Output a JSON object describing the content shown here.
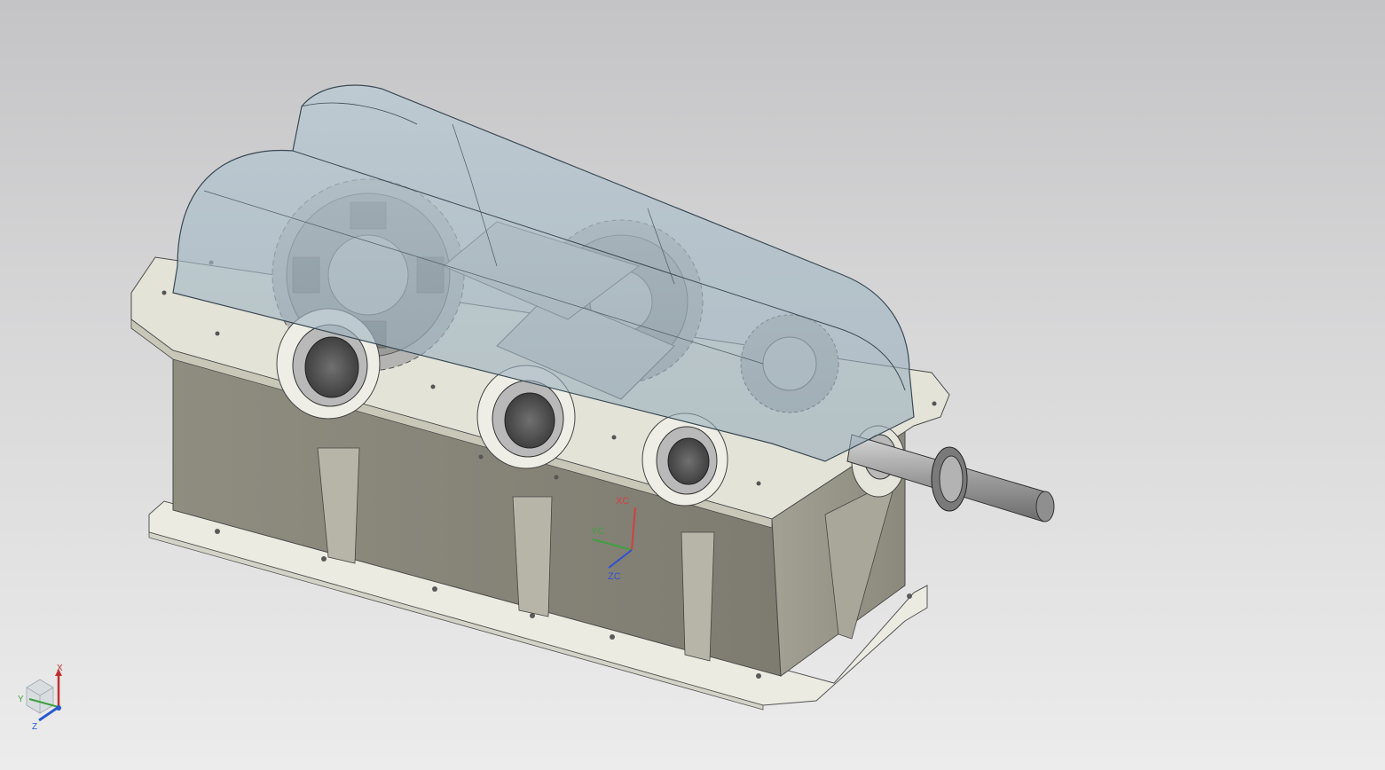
{
  "colors": {
    "background_top": "#c4c4c6",
    "background_bottom": "#ececec",
    "housing": "#8d8b7d",
    "housing_light": "#c9c7b8",
    "flange": "#ecebe2",
    "cover_glass": "#9fb6c4",
    "gear": "#9a9a98",
    "shaft": "#a9a9a9",
    "axis_x": "#d04040",
    "axis_y": "#40a040",
    "axis_z": "#3050d0"
  },
  "icons": {
    "wcs_triad": "work-coordinate-system-triad",
    "view_triad": "view-orientation-triad-cube"
  },
  "wcs": {
    "x_label": "XC",
    "y_label": "YC",
    "z_label": "ZC"
  },
  "view_triad": {
    "x_label": "X",
    "y_label": "Y",
    "z_label": "Z"
  }
}
